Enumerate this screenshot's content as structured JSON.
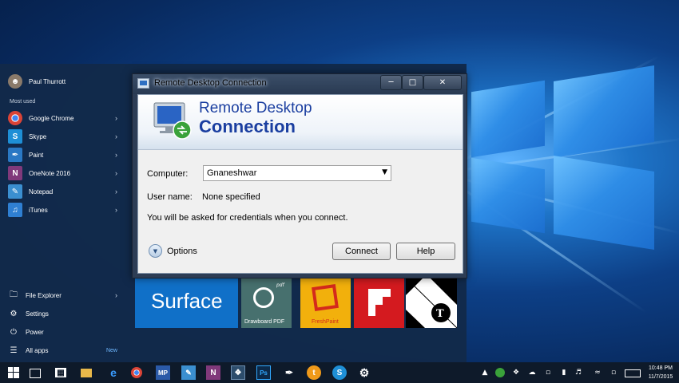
{
  "start_menu": {
    "user_name": "Paul Thurrott",
    "section_most_used": "Most used",
    "apps": [
      {
        "label": "Google Chrome",
        "icon": "chrome-icon",
        "color": "#2b2b2b"
      },
      {
        "label": "Skype",
        "icon": "skype-icon",
        "color": "#1e8fd6"
      },
      {
        "label": "Paint",
        "icon": "paint-icon",
        "color": "#2a78c4"
      },
      {
        "label": "OneNote 2016",
        "icon": "onenote-icon",
        "color": "#80397b"
      },
      {
        "label": "Notepad",
        "icon": "notepad-icon",
        "color": "#3b8fd0"
      },
      {
        "label": "iTunes",
        "icon": "itunes-icon",
        "color": "#2f7fd2"
      }
    ],
    "bottom": {
      "file_explorer": "File Explorer",
      "settings": "Settings",
      "power": "Power",
      "all_apps": "All apps",
      "new_badge": "New"
    },
    "tiles": {
      "surface": "Surface",
      "drawboard": "Drawboard PDF",
      "drawboard_badge": "pdf",
      "freshpaint": "FreshPaint"
    }
  },
  "dialog": {
    "title": "Remote Desktop Connection",
    "banner_line1": "Remote Desktop",
    "banner_line2": "Connection",
    "computer_label": "Computer:",
    "computer_value": "Gnaneshwar",
    "username_label": "User name:",
    "username_value": "None specified",
    "info": "You will be asked for credentials when you connect.",
    "options": "Options",
    "connect": "Connect",
    "help": "Help"
  },
  "taskbar": {
    "time": "10:48 PM",
    "date": "11/7/2015",
    "apps": [
      "task-view-icon",
      "store-icon",
      "file-explorer-icon",
      "edge-icon",
      "chrome-icon",
      "metapad-icon",
      "notepad-icon",
      "onenote-icon",
      "rdc-icon",
      "photoshop-icon",
      "paint-icon",
      "tweet-icon",
      "skype-icon",
      "settings-icon"
    ]
  },
  "colors": {
    "accent_blue": "#0078d7",
    "surface_tile": "#1070c8",
    "drawboard_tile": "#47706e",
    "freshpaint_tile": "#f2b00c",
    "flipboard_tile": "#d41a1f",
    "banner_text": "#1a3ea0"
  }
}
